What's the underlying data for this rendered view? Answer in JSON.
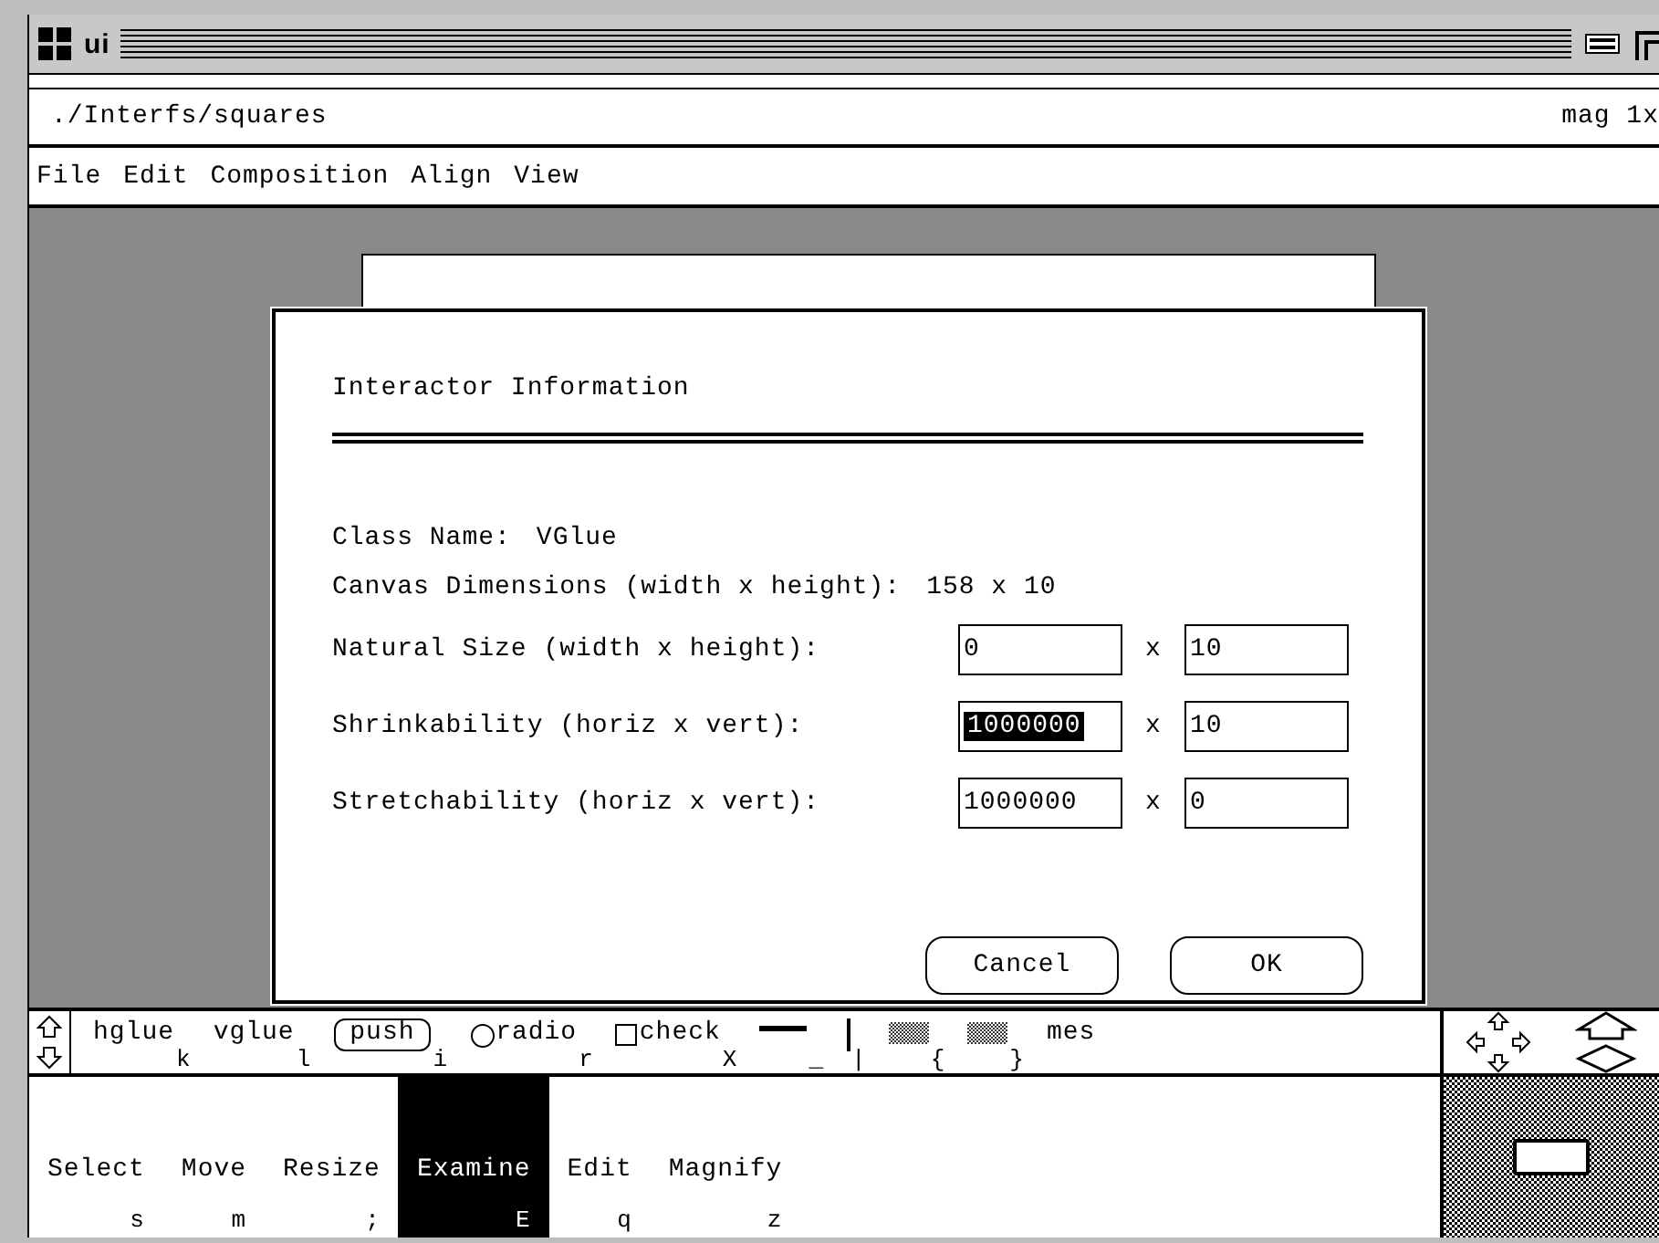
{
  "window": {
    "title": "ui"
  },
  "path_bar": {
    "path": "./Interfs/squares",
    "magnification": "mag 1x"
  },
  "menu": [
    "File",
    "Edit",
    "Composition",
    "Align",
    "View"
  ],
  "dialog": {
    "title": "Interactor Information",
    "info": [
      {
        "label": "Class Name:",
        "value": "VGlue"
      },
      {
        "label": "Canvas Dimensions (width x height):",
        "value": "158 x 10"
      }
    ],
    "fields": [
      {
        "label": "Natural Size (width x height):",
        "first": {
          "value": "0",
          "selected": false
        },
        "separator": "x",
        "second": {
          "value": "10",
          "selected": false
        }
      },
      {
        "label": "Shrinkability (horiz x vert):",
        "first": {
          "value": "1000000",
          "selected": true
        },
        "separator": "x",
        "second": {
          "value": "10",
          "selected": false
        }
      },
      {
        "label": "Stretchability (horiz x vert):",
        "first": {
          "value": "1000000",
          "selected": false
        },
        "separator": "x",
        "second": {
          "value": "0",
          "selected": false
        }
      }
    ],
    "buttons": [
      "Cancel",
      "OK"
    ]
  },
  "palette": [
    {
      "kind": "text",
      "label": "hglue",
      "key": "k"
    },
    {
      "kind": "text",
      "label": "vglue",
      "key": "l"
    },
    {
      "kind": "button",
      "label": "push",
      "key": "i"
    },
    {
      "kind": "radio",
      "label": "radio",
      "key": "r"
    },
    {
      "kind": "check",
      "label": "check",
      "key": "X"
    },
    {
      "kind": "bar",
      "key": "_"
    },
    {
      "kind": "vbar",
      "key": "|"
    },
    {
      "kind": "scroller",
      "key": "{"
    },
    {
      "kind": "scroller",
      "key": "}"
    },
    {
      "kind": "text",
      "label": "mes"
    }
  ],
  "modes": [
    {
      "label": "Select",
      "key": "s",
      "selected": false
    },
    {
      "label": "Move",
      "key": "m",
      "selected": false
    },
    {
      "label": "Resize",
      "key": ";",
      "selected": false
    },
    {
      "label": "Examine",
      "key": "E",
      "selected": true
    },
    {
      "label": "Edit",
      "key": "q",
      "selected": false
    },
    {
      "label": "Magnify",
      "key": "z",
      "selected": false
    }
  ]
}
